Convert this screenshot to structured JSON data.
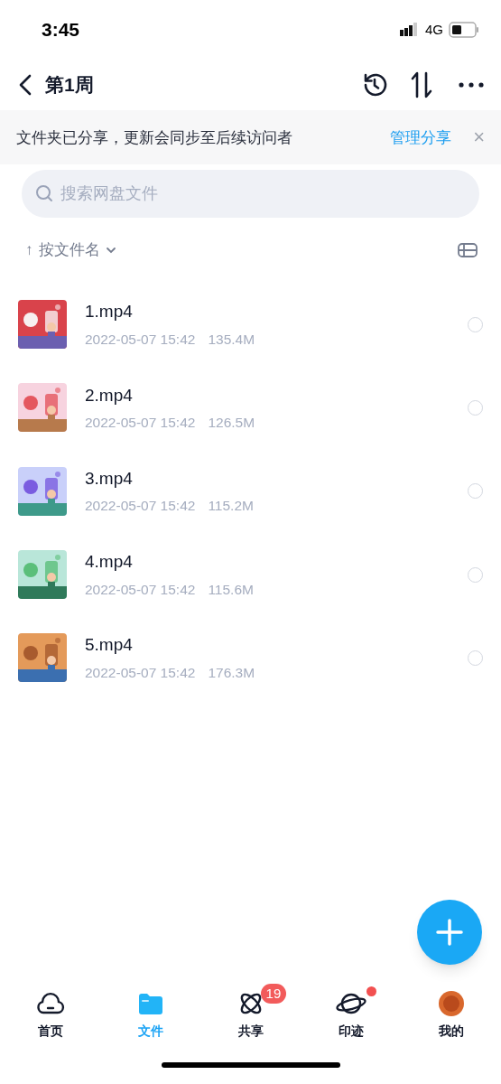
{
  "status_bar": {
    "time": "3:45",
    "network": "4G"
  },
  "header": {
    "title": "第1周"
  },
  "banner": {
    "message": "文件夹已分享，更新会同步至后续访问者",
    "action": "管理分享",
    "close": "×"
  },
  "search": {
    "placeholder": "搜索网盘文件"
  },
  "sort": {
    "arrow": "↑",
    "label": "按文件名"
  },
  "files": [
    {
      "name": "1.mp4",
      "date": "2022-05-07 15:42",
      "size": "135.4M",
      "selected": false
    },
    {
      "name": "2.mp4",
      "date": "2022-05-07 15:42",
      "size": "126.5M",
      "selected": false
    },
    {
      "name": "3.mp4",
      "date": "2022-05-07 15:42",
      "size": "115.2M",
      "selected": false
    },
    {
      "name": "4.mp4",
      "date": "2022-05-07 15:42",
      "size": "115.6M",
      "selected": false
    },
    {
      "name": "5.mp4",
      "date": "2022-05-07 15:42",
      "size": "176.3M",
      "selected": false
    }
  ],
  "tabs": [
    {
      "kind": "home",
      "label": "首页",
      "selected": false
    },
    {
      "kind": "files",
      "label": "文件",
      "selected": true
    },
    {
      "kind": "share",
      "label": "共享",
      "selected": false,
      "badge": "19"
    },
    {
      "kind": "trace",
      "label": "印迹",
      "selected": false,
      "dot": true
    },
    {
      "kind": "me",
      "label": "我的",
      "selected": false
    }
  ]
}
